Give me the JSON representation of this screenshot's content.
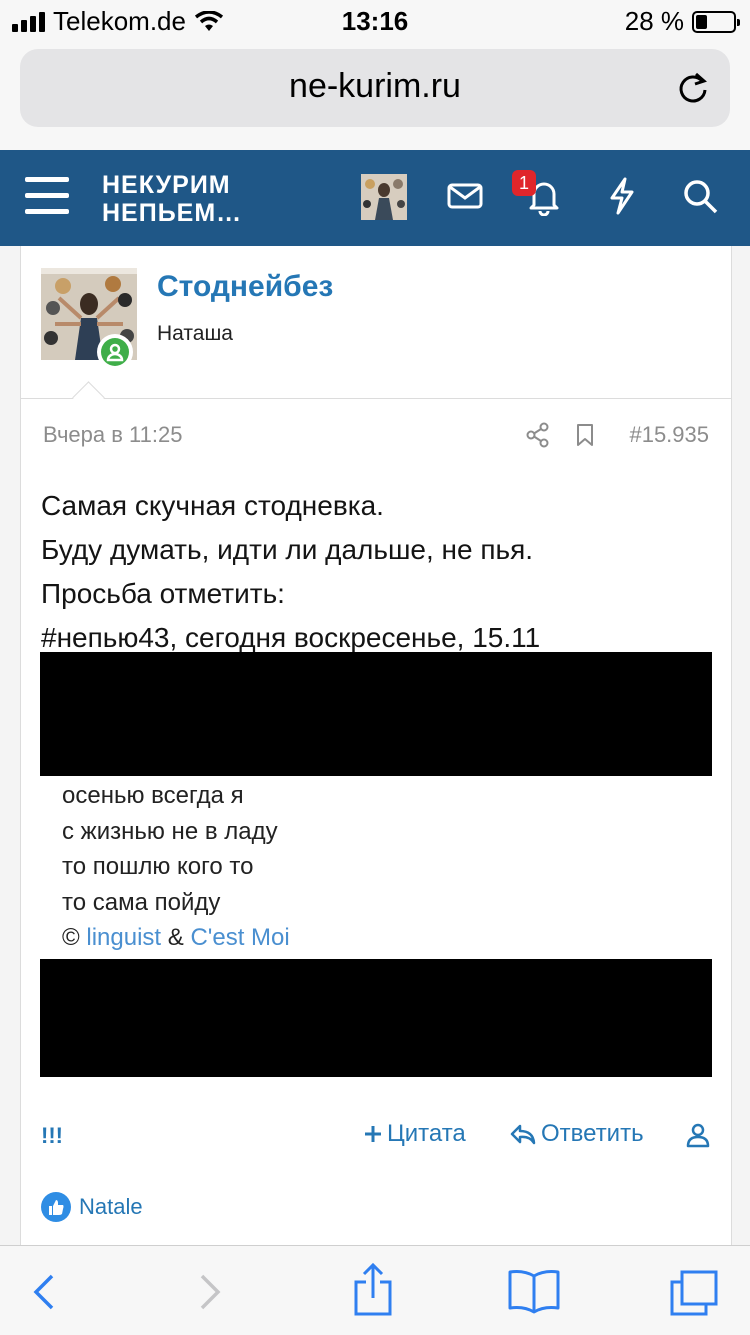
{
  "status_bar": {
    "carrier": "Telekom.de",
    "time": "13:16",
    "battery": "28 %"
  },
  "browser": {
    "url": "ne-kurim.ru"
  },
  "nav": {
    "logo_line1": "НЕКУРИМ",
    "logo_line2": "НЕПЬЕМ…",
    "alerts_count": "1"
  },
  "post": {
    "username": "Стоднейбез",
    "user_title": "Наташа",
    "date": "Вчера в 11:25",
    "post_number": "#15.935",
    "lines": [
      "Самая скучная стодневка.",
      "Буду думать, идти ли дальше, не пья.",
      "Просьба отметить:",
      "#непью43, сегодня воскресенье, 15.11"
    ],
    "quote_image": {
      "lines": [
        "осенью всегда я",
        "с жизнью не в ладу",
        "то пошлю кого то",
        "то сама пойду"
      ],
      "copyright": "©",
      "author1": "linguist",
      "amp": "&",
      "author2": "C'est Moi"
    },
    "actions": {
      "bangs": "!!!",
      "quote": "Цитата",
      "reply": "Ответить"
    },
    "reaction_user": "Natale"
  },
  "colors": {
    "nav_bg": "#1f5787",
    "link": "#2577b5",
    "badge": "#e0262b",
    "online": "#3fae49",
    "ios_blue": "#2f7ff0"
  }
}
